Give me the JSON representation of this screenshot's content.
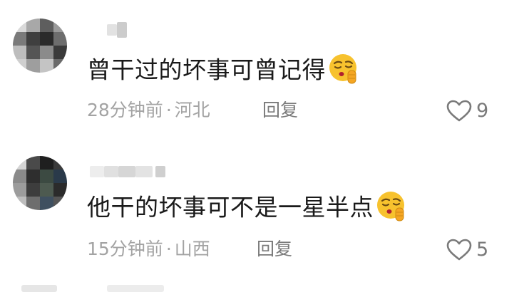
{
  "comments": [
    {
      "text": "曾干过的坏事可曾记得",
      "time": "28分钟前",
      "separator": "·",
      "location": "河北",
      "reply_label": "回复",
      "like_count": "9",
      "emoji": "shushing-face-emoji"
    },
    {
      "text": "他干的坏事可不是一星半点",
      "time": "15分钟前",
      "separator": "·",
      "location": "山西",
      "reply_label": "回复",
      "like_count": "5",
      "emoji": "shushing-face-emoji"
    }
  ],
  "colors": {
    "text": "#1a1a1a",
    "meta": "#a3a3a3",
    "action": "#7a7a7a",
    "emoji_face": "#f7c22e"
  }
}
